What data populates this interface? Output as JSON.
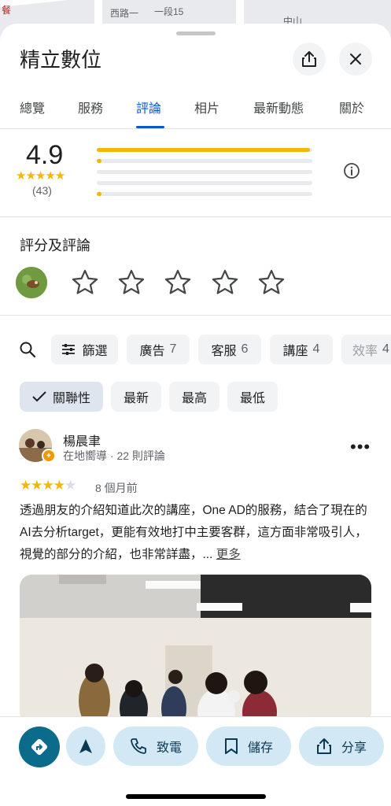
{
  "map": {
    "labels": [
      "餐",
      "西路一",
      "一段15",
      "中山"
    ]
  },
  "place": {
    "name": "精立數位"
  },
  "header": {
    "share_icon": "share-icon",
    "close_icon": "close-icon"
  },
  "tabs": [
    {
      "label": "總覽"
    },
    {
      "label": "服務"
    },
    {
      "label": "評論",
      "active": true
    },
    {
      "label": "相片"
    },
    {
      "label": "最新動態"
    },
    {
      "label": "關於"
    }
  ],
  "rating": {
    "score": "4.9",
    "stars": "★★★★★",
    "count": "(43)",
    "distribution": [
      0.99,
      0.01,
      0,
      0,
      0.01
    ]
  },
  "rate_section": {
    "title": "評分及評論",
    "empty_stars": 5
  },
  "filters": {
    "search_icon": "search-icon",
    "sort_label": "篩選",
    "topics": [
      {
        "label": "廣告",
        "count": "7"
      },
      {
        "label": "客服",
        "count": "6"
      },
      {
        "label": "講座",
        "count": "4"
      },
      {
        "label": "效率",
        "count": "4"
      }
    ],
    "sorts": [
      {
        "label": "關聯性",
        "selected": true
      },
      {
        "label": "最新"
      },
      {
        "label": "最高"
      },
      {
        "label": "最低"
      }
    ]
  },
  "review": {
    "author": "楊晨聿",
    "meta": "在地嚮導 · 22 則評論",
    "stars": 4,
    "date": "8 個月前",
    "text": "透過朋友的介紹知道此次的講座，One AD的服務，結合了現在的AI去分析target，更能有效地打中主要客群，這方面非常吸引人，視覺的部分的介紹，也非常詳盡，...",
    "more": "更多"
  },
  "actions": [
    {
      "label": "",
      "icon": "directions-icon"
    },
    {
      "label": "",
      "icon": "navigate-arrow-icon"
    },
    {
      "label": "致電",
      "icon": "phone-icon"
    },
    {
      "label": "儲存",
      "icon": "bookmark-icon"
    },
    {
      "label": "分享",
      "icon": "share-icon"
    }
  ],
  "colors": {
    "accent": "#0b57d0",
    "star": "#f5b50a",
    "action_bg": "#d3e8f5",
    "directions": "#0b6b8a"
  }
}
